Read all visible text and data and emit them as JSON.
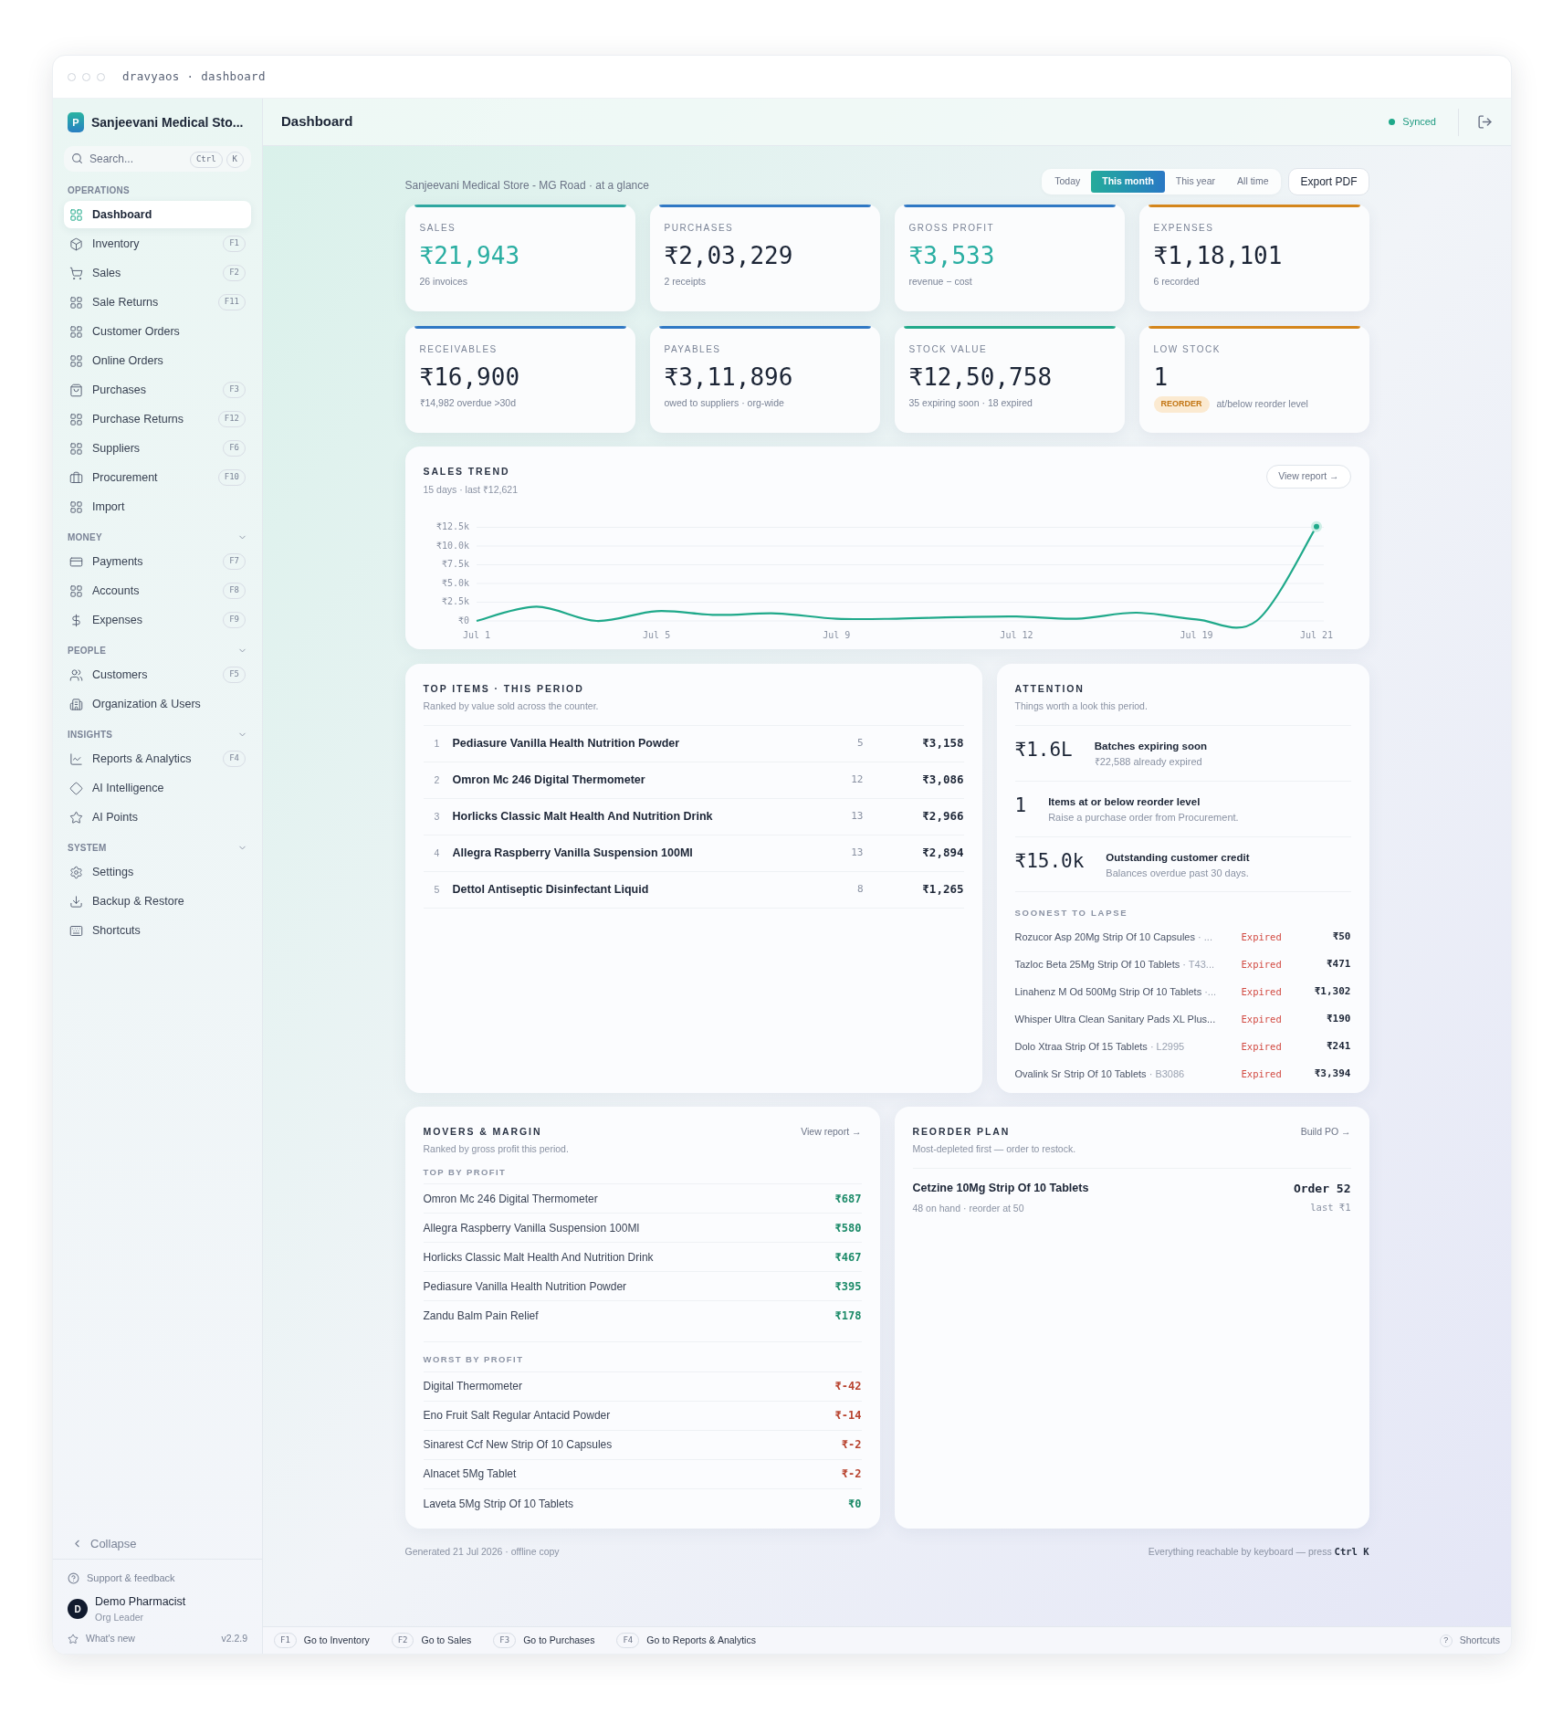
{
  "window": {
    "title": "dravyaos · dashboard"
  },
  "sidebar": {
    "logo_letter": "P",
    "store_name": "Sanjeevani Medical Sto...",
    "search": {
      "placeholder": "Search...",
      "keys": [
        "Ctrl",
        "K"
      ]
    },
    "sections": [
      {
        "title": "OPERATIONS",
        "collapsible": false,
        "items": [
          {
            "label": "Dashboard",
            "kind": "grid",
            "selected": true
          },
          {
            "label": "Inventory",
            "kind": "box",
            "shortcut": "F1",
            "selected": false
          },
          {
            "label": "Sales",
            "kind": "cart",
            "shortcut": "F2",
            "selected": false
          },
          {
            "label": "Sale Returns",
            "kind": "grid",
            "shortcut": "F11",
            "selected": false
          },
          {
            "label": "Customer Orders",
            "kind": "grid",
            "selected": false
          },
          {
            "label": "Online Orders",
            "kind": "grid",
            "selected": false
          },
          {
            "label": "Purchases",
            "kind": "bag",
            "shortcut": "F3",
            "selected": false
          },
          {
            "label": "Purchase Returns",
            "kind": "grid",
            "shortcut": "F12",
            "selected": false
          },
          {
            "label": "Suppliers",
            "kind": "grid",
            "shortcut": "F6",
            "selected": false
          },
          {
            "label": "Procurement",
            "kind": "briefcase",
            "shortcut": "F10",
            "selected": false
          },
          {
            "label": "Import",
            "kind": "grid",
            "selected": false
          }
        ]
      },
      {
        "title": "MONEY",
        "collapsible": true,
        "items": [
          {
            "label": "Payments",
            "kind": "card",
            "shortcut": "F7",
            "selected": false
          },
          {
            "label": "Accounts",
            "kind": "grid",
            "shortcut": "F8",
            "selected": false
          },
          {
            "label": "Expenses",
            "kind": "dollar",
            "shortcut": "F9",
            "selected": false
          }
        ]
      },
      {
        "title": "PEOPLE",
        "collapsible": true,
        "items": [
          {
            "label": "Customers",
            "kind": "users",
            "shortcut": "F5",
            "selected": false
          },
          {
            "label": "Organization & Users",
            "kind": "building",
            "selected": false
          }
        ]
      },
      {
        "title": "INSIGHTS",
        "collapsible": true,
        "items": [
          {
            "label": "Reports & Analytics",
            "kind": "chart",
            "shortcut": "F4",
            "selected": false
          },
          {
            "label": "AI Intelligence",
            "kind": "diamond",
            "selected": false
          },
          {
            "label": "AI Points",
            "kind": "star",
            "selected": false
          }
        ]
      },
      {
        "title": "SYSTEM",
        "collapsible": true,
        "items": [
          {
            "label": "Settings",
            "kind": "settings",
            "selected": false
          },
          {
            "label": "Backup & Restore",
            "kind": "download",
            "selected": false
          },
          {
            "label": "Shortcuts",
            "kind": "keyboard",
            "selected": false
          }
        ]
      }
    ],
    "collapse": "Collapse",
    "support": "Support & feedback",
    "user": {
      "initial": "D",
      "name": "Demo Pharmacist",
      "role": "Org Leader"
    },
    "whats_new": "What's new",
    "version": "v2.2.9"
  },
  "header": {
    "title": "Dashboard",
    "sync_status": "Synced"
  },
  "overview": {
    "subtitle": "Sanjeevani Medical Store - MG Road · at a glance",
    "periods": [
      {
        "label": "Today",
        "selected": false
      },
      {
        "label": "This month",
        "selected": true
      },
      {
        "label": "This year",
        "selected": false
      },
      {
        "label": "All time",
        "selected": false
      }
    ],
    "export": "Export PDF"
  },
  "kpis": [
    {
      "label": "SALES",
      "value": "₹21,943",
      "note": "26 invoices",
      "color": "#2fa7a0",
      "highlight": true
    },
    {
      "label": "PURCHASES",
      "value": "₹2,03,229",
      "note": "2 receipts",
      "color": "#2f78c4",
      "highlight": false
    },
    {
      "label": "GROSS PROFIT",
      "value": "₹3,533",
      "note": "revenue − cost",
      "color": "#2f78c4",
      "highlight": true
    },
    {
      "label": "EXPENSES",
      "value": "₹1,18,101",
      "note": "6 recorded",
      "color": "#d4861c",
      "highlight": false
    },
    {
      "label": "RECEIVABLES",
      "value": "₹16,900",
      "note": "₹14,982 overdue >30d",
      "color": "#2f78c4",
      "highlight": false
    },
    {
      "label": "PAYABLES",
      "value": "₹3,11,896",
      "note": "owed to suppliers · org-wide",
      "color": "#2f78c4",
      "highlight": false
    },
    {
      "label": "STOCK VALUE",
      "value": "₹12,50,758",
      "note": "35 expiring soon · 18 expired",
      "color": "#22a98a",
      "highlight": false
    },
    {
      "label": "LOW STOCK",
      "value": "1",
      "badge": "REORDER",
      "note": "at/below reorder level",
      "color": "#d4861c",
      "highlight": false
    }
  ],
  "sales_trend": {
    "title": "SALES TREND",
    "subtitle": "15 days · last ₹12,621",
    "link": "View report →",
    "chart_data": {
      "type": "line",
      "categories": [
        "Jul 1",
        null,
        null,
        "Jul 5",
        null,
        null,
        "Jul 9",
        null,
        null,
        "Jul 12",
        null,
        null,
        "Jul 19",
        null,
        "Jul 21"
      ],
      "series": [
        {
          "color": "#1fa98a",
          "values": [
            0,
            1900,
            0,
            1300,
            800,
            1000,
            300,
            300,
            500,
            600,
            300,
            1100,
            200,
            0,
            12600
          ]
        }
      ],
      "ylim": [
        0,
        12800
      ],
      "grid": true,
      "yticks": [
        {
          "value": 0,
          "label": "₹0"
        },
        {
          "value": 2500,
          "label": "₹2.5k"
        },
        {
          "value": 5000,
          "label": "₹5.0k"
        },
        {
          "value": 7500,
          "label": "₹7.5k"
        },
        {
          "value": 10000,
          "label": "₹10.0k"
        },
        {
          "value": 12500,
          "label": "₹12.5k"
        }
      ]
    }
  },
  "top_items": {
    "title": "TOP ITEMS · THIS PERIOD",
    "subtitle": "Ranked by value sold across the counter.",
    "rows": [
      {
        "rank": "1",
        "name": "Pediasure Vanilla Health Nutrition Powder",
        "qty": "5",
        "amount": "₹3,158"
      },
      {
        "rank": "2",
        "name": "Omron Mc 246 Digital Thermometer",
        "qty": "12",
        "amount": "₹3,086"
      },
      {
        "rank": "3",
        "name": "Horlicks Classic Malt Health And Nutrition Drink",
        "qty": "13",
        "amount": "₹2,966"
      },
      {
        "rank": "4",
        "name": "Allegra Raspberry Vanilla Suspension 100Ml",
        "qty": "13",
        "amount": "₹2,894"
      },
      {
        "rank": "5",
        "name": "Dettol Antiseptic Disinfectant Liquid",
        "qty": "8",
        "amount": "₹1,265"
      }
    ]
  },
  "attention": {
    "title": "ATTENTION",
    "subtitle": "Things worth a look this period.",
    "items": [
      {
        "figure": "₹1.6L",
        "title": "Batches expiring soon",
        "detail": "₹22,588 already expired"
      },
      {
        "figure": "1",
        "title": "Items at or below reorder level",
        "detail": "Raise a purchase order from Procurement."
      },
      {
        "figure": "₹15.0k",
        "title": "Outstanding customer credit",
        "detail": "Balances overdue past 30 days."
      }
    ],
    "lapse_title": "SOONEST TO LAPSE",
    "lapse_rows": [
      {
        "name": "Rozucor Asp 20Mg Strip Of 10 Capsules",
        "batch": "· ...",
        "status": "Expired",
        "amount": "₹50"
      },
      {
        "name": "Tazloc Beta 25Mg Strip Of 10 Tablets",
        "batch": "· T43...",
        "status": "Expired",
        "amount": "₹471"
      },
      {
        "name": "Linahenz M Od 500Mg Strip Of 10 Tablets",
        "batch": "·...",
        "status": "Expired",
        "amount": "₹1,302"
      },
      {
        "name": "Whisper Ultra Clean Sanitary Pads XL Plus...",
        "status": "Expired",
        "amount": "₹190"
      },
      {
        "name": "Dolo Xtraa Strip Of 15 Tablets",
        "batch": "· L2995",
        "status": "Expired",
        "amount": "₹241"
      },
      {
        "name": "Ovalink Sr Strip Of 10 Tablets",
        "batch": "· B3086",
        "status": "Expired",
        "amount": "₹3,394"
      }
    ]
  },
  "movers": {
    "title": "MOVERS & MARGIN",
    "subtitle": "Ranked by gross profit this period.",
    "link": "View report →",
    "groups": [
      {
        "title": "TOP BY PROFIT",
        "rows": [
          {
            "name": "Omron Mc 246 Digital Thermometer",
            "amount": "₹687",
            "color": "#1b8a68"
          },
          {
            "name": "Allegra Raspberry Vanilla Suspension 100Ml",
            "amount": "₹580",
            "color": "#1b8a68"
          },
          {
            "name": "Horlicks Classic Malt Health And Nutrition Drink",
            "amount": "₹467",
            "color": "#1b8a68"
          },
          {
            "name": "Pediasure Vanilla Health Nutrition Powder",
            "amount": "₹395",
            "color": "#1b8a68"
          },
          {
            "name": "Zandu Balm Pain Relief",
            "amount": "₹178",
            "color": "#1b8a68"
          }
        ]
      },
      {
        "title": "WORST BY PROFIT",
        "rows": [
          {
            "name": "Digital Thermometer",
            "amount": "₹-42",
            "color": "#b8432f"
          },
          {
            "name": "Eno Fruit Salt Regular Antacid Powder",
            "amount": "₹-14",
            "color": "#b8432f"
          },
          {
            "name": "Sinarest Ccf New Strip Of 10 Capsules",
            "amount": "₹-2",
            "color": "#b8432f"
          },
          {
            "name": "Alnacet 5Mg Tablet",
            "amount": "₹-2",
            "color": "#b8432f"
          },
          {
            "name": "Laveta 5Mg Strip Of 10 Tablets",
            "amount": "₹0",
            "color": "#1b8a68"
          }
        ]
      }
    ]
  },
  "reorder": {
    "title": "REORDER PLAN",
    "subtitle": "Most-depleted first — order to restock.",
    "link": "Build PO →",
    "rows": [
      {
        "name": "Cetzine 10Mg Strip Of 10 Tablets",
        "detail": "48 on hand · reorder at 50",
        "order": "Order 52",
        "last": "last ₹1"
      }
    ]
  },
  "footer": {
    "generated": "Generated 21 Jul 2026 · offline copy",
    "hint": "Everything reachable by keyboard — press",
    "hint_keys": "Ctrl K"
  },
  "shortcut_bar": {
    "items": [
      {
        "key": "F1",
        "label": "Go to Inventory"
      },
      {
        "key": "F2",
        "label": "Go to Sales"
      },
      {
        "key": "F3",
        "label": "Go to Purchases"
      },
      {
        "key": "F4",
        "label": "Go to Reports & Analytics"
      }
    ],
    "help_icon": "?",
    "help": "Shortcuts"
  }
}
